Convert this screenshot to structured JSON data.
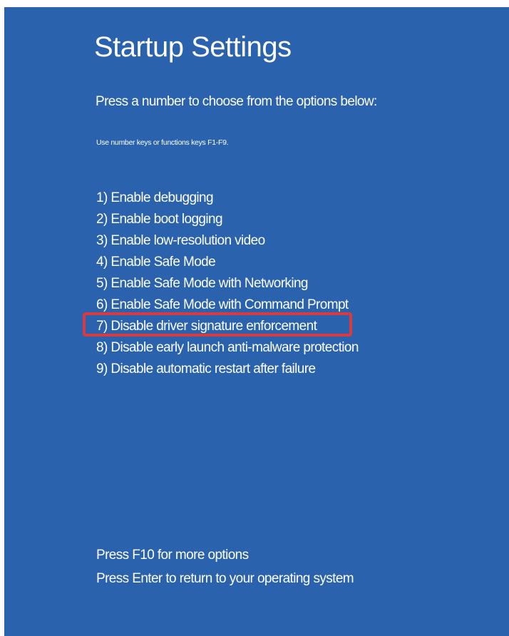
{
  "screen": {
    "title": "Startup Settings",
    "subtitle": "Press a number to choose from the options below:",
    "hint": "Use number keys or functions keys F1-F9."
  },
  "options": [
    {
      "label": "1) Enable debugging"
    },
    {
      "label": "2) Enable boot logging"
    },
    {
      "label": "3) Enable low-resolution video"
    },
    {
      "label": "4) Enable Safe Mode"
    },
    {
      "label": "5) Enable Safe Mode with Networking"
    },
    {
      "label": "6) Enable Safe Mode with Command Prompt"
    },
    {
      "label": "7) Disable driver signature enforcement",
      "highlighted": true
    },
    {
      "label": "8) Disable early launch anti-malware protection"
    },
    {
      "label": "9) Disable automatic restart after failure"
    }
  ],
  "footer": {
    "more_options": "Press F10 for more options",
    "return": "Press Enter to return to your operating system"
  },
  "colors": {
    "background": "#2a62ad",
    "text": "#ffffff",
    "highlight_border": "#d83a3f"
  }
}
